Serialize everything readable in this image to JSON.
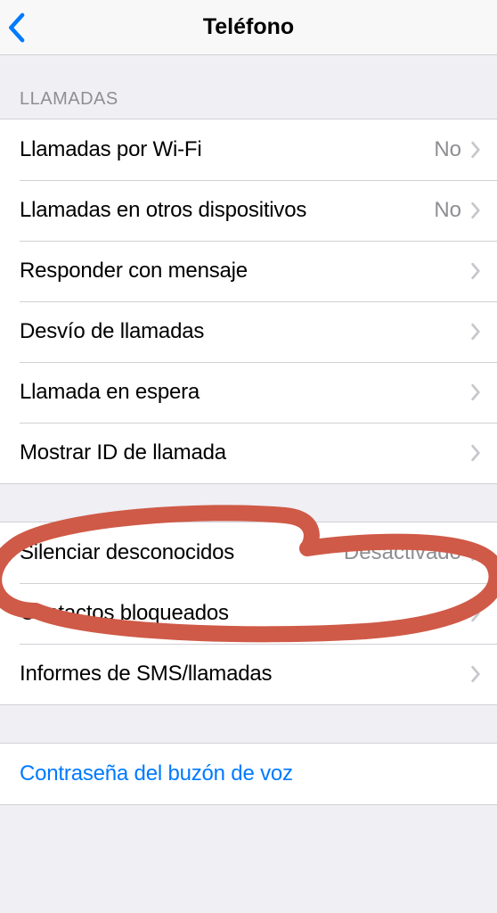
{
  "header": {
    "title": "Teléfono"
  },
  "sections": {
    "calls_header": "LLAMADAS",
    "wifi_calls": {
      "label": "Llamadas por Wi-Fi",
      "value": "No"
    },
    "other_devices": {
      "label": "Llamadas en otros dispositivos",
      "value": "No"
    },
    "respond_message": {
      "label": "Responder con mensaje"
    },
    "call_forwarding": {
      "label": "Desvío de llamadas"
    },
    "call_waiting": {
      "label": "Llamada en espera"
    },
    "show_caller_id": {
      "label": "Mostrar ID de llamada"
    },
    "silence_unknown": {
      "label": "Silenciar desconocidos",
      "value": "Desactivado"
    },
    "blocked_contacts": {
      "label": "Contactos bloqueados"
    },
    "sms_reports": {
      "label": "Informes de SMS/llamadas"
    },
    "voicemail_password": {
      "label": "Contraseña del buzón de voz"
    }
  }
}
